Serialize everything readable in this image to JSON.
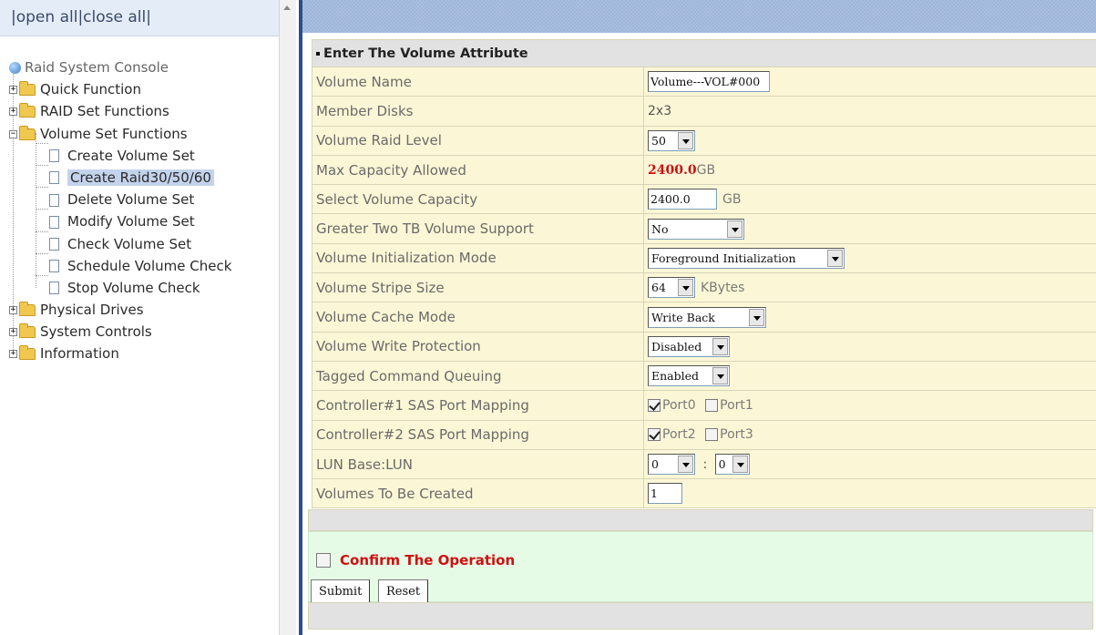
{
  "nav": {
    "open_all": "open all",
    "close_all": "close all",
    "sep": "|"
  },
  "tree": {
    "root": "Raid System Console",
    "items": [
      {
        "label": "Quick Function",
        "expanded": false
      },
      {
        "label": "RAID Set Functions",
        "expanded": false
      },
      {
        "label": "Volume Set Functions",
        "expanded": true
      },
      {
        "label": "Physical Drives",
        "expanded": false
      },
      {
        "label": "System Controls",
        "expanded": false
      },
      {
        "label": "Information",
        "expanded": false
      }
    ],
    "sub": [
      "Create Volume Set",
      "Create Raid30/50/60",
      "Delete Volume Set",
      "Modify Volume Set",
      "Check Volume Set",
      "Schedule Volume Check",
      "Stop Volume Check"
    ],
    "selected": "Create Raid30/50/60"
  },
  "form": {
    "header": "Enter The Volume Attribute",
    "rows": {
      "volume_name": {
        "label": "Volume Name",
        "value": "Volume---VOL#000"
      },
      "member_disks": {
        "label": "Member Disks",
        "value": "2x3"
      },
      "raid_level": {
        "label": "Volume Raid Level",
        "value": "50"
      },
      "max_capacity": {
        "label": "Max Capacity Allowed",
        "value": "2400.0",
        "unit": "GB"
      },
      "select_capacity": {
        "label": "Select Volume Capacity",
        "value": "2400.0",
        "unit": "GB"
      },
      "greater_two_tb": {
        "label": "Greater Two TB Volume Support",
        "value": "No"
      },
      "init_mode": {
        "label": "Volume Initialization Mode",
        "value": "Foreground Initialization"
      },
      "stripe_size": {
        "label": "Volume Stripe Size",
        "value": "64",
        "unit": "KBytes"
      },
      "cache_mode": {
        "label": "Volume Cache Mode",
        "value": "Write Back"
      },
      "write_protection": {
        "label": "Volume Write Protection",
        "value": "Disabled"
      },
      "tcq": {
        "label": "Tagged Command Queuing",
        "value": "Enabled"
      },
      "ctrl1": {
        "label": "Controller#1 SAS Port Mapping",
        "port_a": "Port0",
        "port_b": "Port1",
        "port_a_checked": true,
        "port_b_checked": false
      },
      "ctrl2": {
        "label": "Controller#2 SAS Port Mapping",
        "port_a": "Port2",
        "port_b": "Port3",
        "port_a_checked": true,
        "port_b_checked": false
      },
      "lun": {
        "label": "LUN Base:LUN",
        "base": "0",
        "sep": ":",
        "lun": "0"
      },
      "volumes_count": {
        "label": "Volumes To Be Created",
        "value": "1"
      }
    },
    "confirm": "Confirm The Operation",
    "submit": "Submit",
    "reset": "Reset"
  },
  "colors": {
    "accent_red": "#cc1010",
    "label_bg": "#fbf7d6",
    "confirm_bg": "#e6fbe6",
    "frame_border": "#2b4f8a"
  }
}
